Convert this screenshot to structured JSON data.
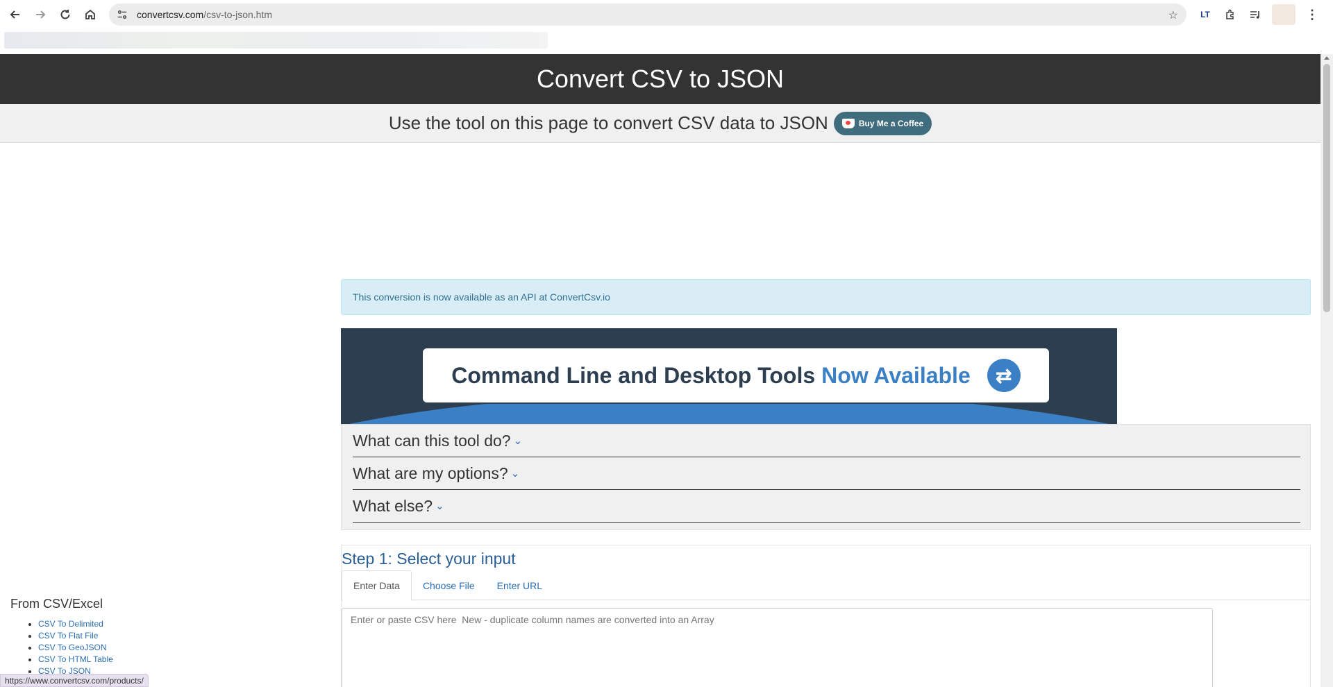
{
  "browser": {
    "url_host": "convertcsv.com",
    "url_path": "/csv-to-json.htm",
    "status_url": "https://www.convertcsv.com/products/"
  },
  "page": {
    "title": "Convert CSV to JSON",
    "subtitle": "Use the tool on this page to convert CSV data to JSON",
    "coffee_label": "Buy Me a Coffee",
    "api_notice": "This conversion is now available as an API at ConvertCsv.io",
    "banner": {
      "text": "Command Line and Desktop Tools",
      "highlight": "Now Available"
    },
    "faq": [
      {
        "label": "What can this tool do?"
      },
      {
        "label": "What are my options?"
      },
      {
        "label": "What else?"
      }
    ],
    "step1": {
      "title": "Step 1: Select your input",
      "tabs": [
        {
          "label": "Enter Data"
        },
        {
          "label": "Choose File"
        },
        {
          "label": "Enter URL"
        }
      ],
      "input_placeholder": "Enter or paste CSV here  New - duplicate column names are converted into an Array"
    },
    "sidebar": {
      "heading": "From CSV/Excel",
      "links": [
        {
          "label": "CSV To Delimited"
        },
        {
          "label": "CSV To Flat File"
        },
        {
          "label": "CSV To GeoJSON"
        },
        {
          "label": "CSV To HTML Table"
        },
        {
          "label": "CSV To JSON"
        }
      ]
    }
  },
  "colors": {
    "title_bar": "#333333",
    "link": "#2a6db0",
    "alert_bg": "#d9edf7",
    "banner_dark": "#2c3e50",
    "banner_blue": "#3b7fc4"
  }
}
